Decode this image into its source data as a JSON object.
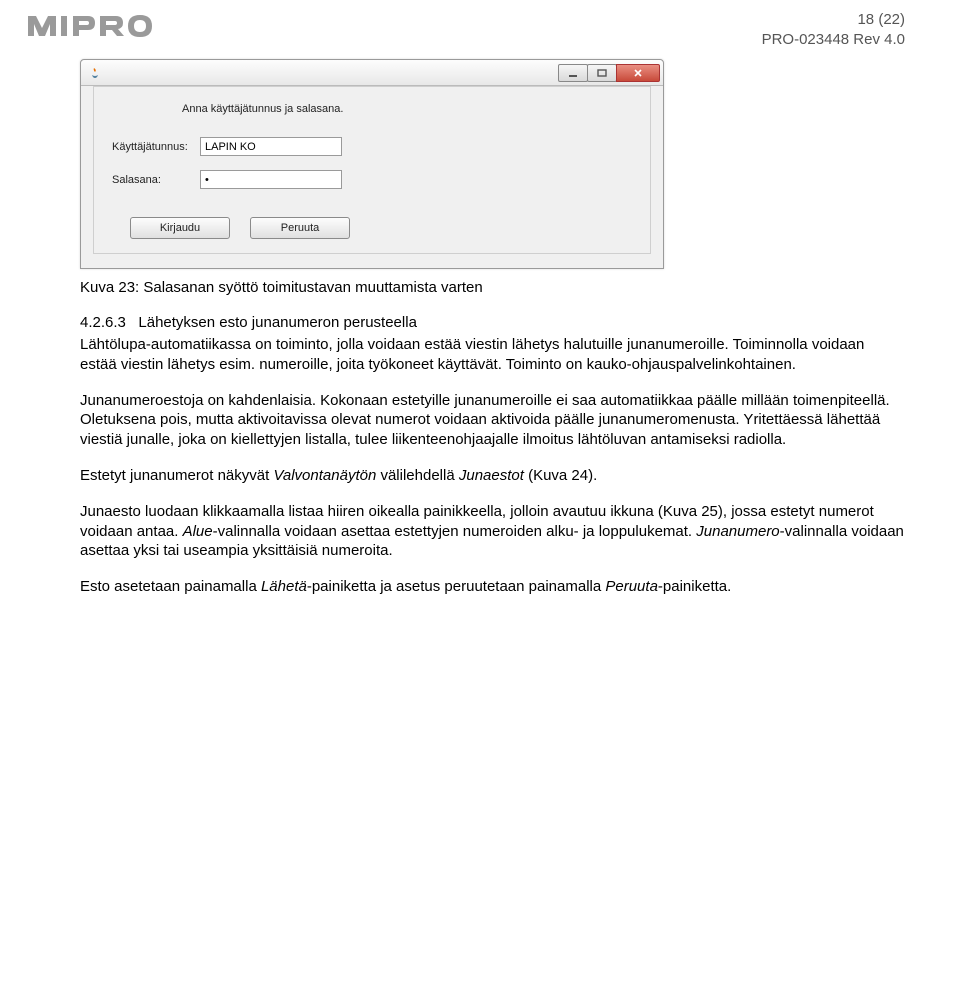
{
  "header": {
    "page_indicator": "18 (22)",
    "doc_id": "PRO-023448 Rev 4.0"
  },
  "screenshot": {
    "prompt": "Anna käyttäjätunnus ja salasana.",
    "username_label": "Käyttäjätunnus:",
    "password_label": "Salasana:",
    "username_value": "LAPIN KO",
    "password_value": "•",
    "login_button": "Kirjaudu",
    "cancel_button": "Peruuta"
  },
  "caption": "Kuva 23: Salasanan syöttö toimitustavan muuttamista varten",
  "section_number": "4.2.6.3",
  "section_title": "Lähetyksen esto junanumeron perusteella",
  "para1": "Lähtölupa-automatiikassa on toiminto, jolla voidaan estää viestin lähetys halutuille junanumeroille. Toiminnolla voidaan estää viestin lähetys esim. numeroille, joita työkoneet käyttävät. Toiminto on kauko-ohjauspalvelinkohtainen.",
  "para2": "Junanumeroestoja on kahdenlaisia. Kokonaan estetyille junanumeroille ei saa automatiikkaa päälle millään toimenpiteellä. Oletuksena pois, mutta aktivoitavissa olevat numerot voidaan aktivoida päälle junanumeromenusta. Yritettäessä lähettää viestiä junalle, joka on kiellettyjen listalla, tulee liikenteenohjaajalle ilmoitus lähtöluvan antamiseksi radiolla.",
  "para3_a": "Estetyt junanumerot näkyvät ",
  "para3_i1": "Valvontanäytön",
  "para3_b": " välilehdellä ",
  "para3_i2": "Junaestot",
  "para3_c": " (Kuva 24).",
  "para4_a": "Junaesto luodaan klikkaamalla listaa hiiren oikealla painikkeella, jolloin avautuu ikkuna (Kuva 25), jossa estetyt numerot voidaan antaa. ",
  "para4_i1": "Alue",
  "para4_b": "-valinnalla voidaan asettaa estettyjen numeroiden alku- ja loppulukemat. ",
  "para4_i2": "Junanumero",
  "para4_c": "-valinnalla voidaan asettaa yksi tai useampia yksittäisiä numeroita.",
  "para5_a": "Esto asetetaan painamalla ",
  "para5_i1": "Lähetä",
  "para5_b": "-painiketta ja asetus peruutetaan painamalla ",
  "para5_i2": "Peruuta",
  "para5_c": "-painiketta."
}
